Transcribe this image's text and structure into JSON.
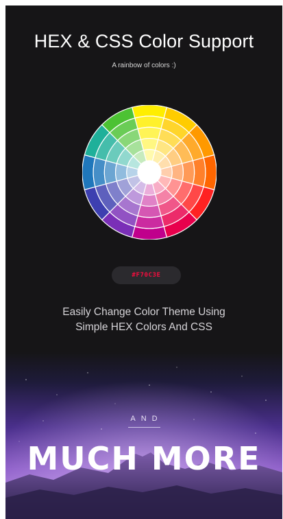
{
  "header": {
    "title": "HEX & CSS Color Support",
    "subtitle": "A rainbow of colors :)"
  },
  "color_wheel": {
    "segments": 12,
    "rings": 5,
    "hues": [
      "#ffee00",
      "#ffcc00",
      "#ff9900",
      "#ff6600",
      "#ff2222",
      "#e8004c",
      "#c0008c",
      "#7a2fb7",
      "#3d3fb0",
      "#1f77bb",
      "#1fb09a",
      "#4cc233"
    ],
    "center": "#ffffff",
    "divider": "#ffffff"
  },
  "hex_badge": {
    "value": "#F70C3E",
    "color": "#f70c3e"
  },
  "description": {
    "line1": "Easily Change Color Theme Using",
    "line2": "Simple HEX Colors And CSS"
  },
  "promo": {
    "kicker": "AND",
    "headline": "MUCH MORE"
  }
}
